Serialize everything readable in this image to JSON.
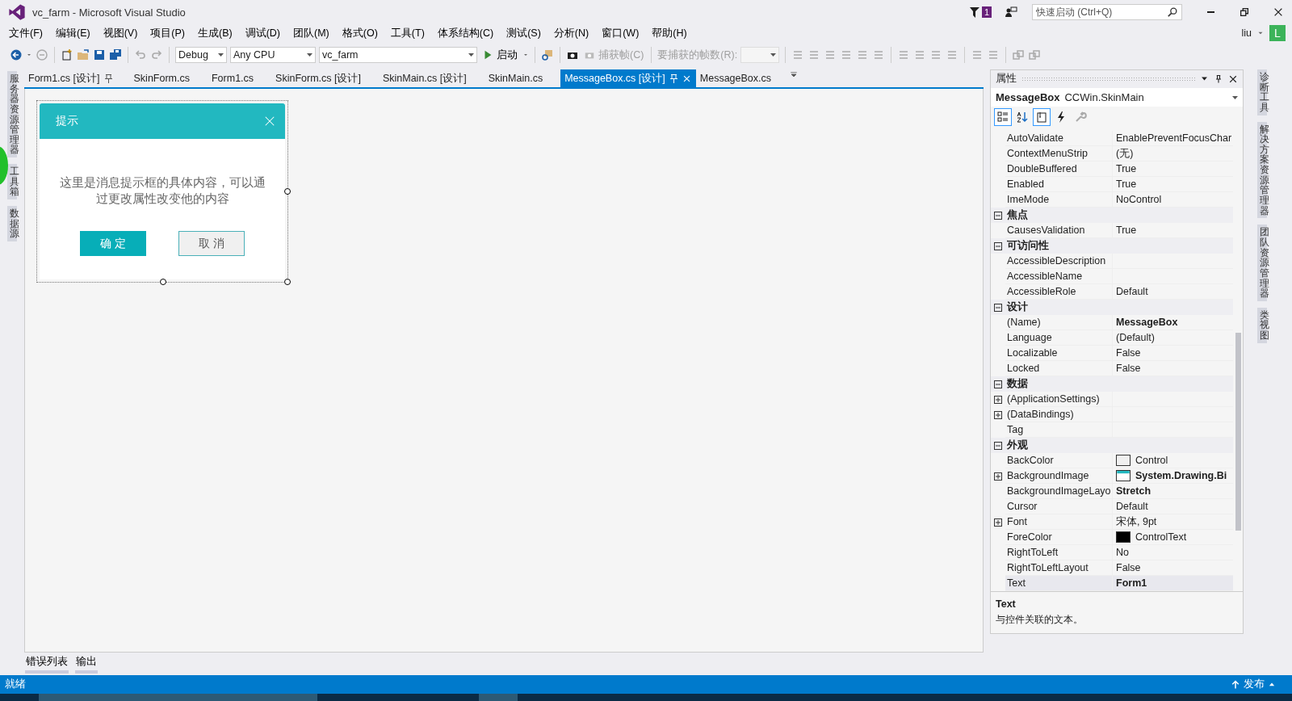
{
  "window": {
    "title": "vc_farm - Microsoft Visual Studio",
    "notification_count": "1",
    "quick_launch": {
      "placeholder": "快速启动 (Ctrl+Q)"
    }
  },
  "menu": [
    "文件(F)",
    "编辑(E)",
    "视图(V)",
    "项目(P)",
    "生成(B)",
    "调试(D)",
    "团队(M)",
    "格式(O)",
    "工具(T)",
    "体系结构(C)",
    "测试(S)",
    "分析(N)",
    "窗口(W)",
    "帮助(H)"
  ],
  "account": {
    "user": "liu",
    "initial": "L"
  },
  "toolbar": {
    "configuration": "Debug",
    "platform": "Any CPU",
    "project": "vc_farm",
    "start": "启动",
    "capture": {
      "label": "捕获帧(C)",
      "disabled": true
    },
    "frames_label": "要捕获的帧数(R):"
  },
  "left_strip": [
    "服务器资源管理器",
    "工具箱",
    "数据源"
  ],
  "right_strip": [
    "诊断工具",
    "解决方案资源管理器",
    "团队资源管理器",
    "类视图"
  ],
  "tabs": [
    {
      "label": "Form1.cs [设计]",
      "selected": false,
      "pinned": true
    },
    {
      "label": "SkinForm.cs",
      "selected": false,
      "pinned": false
    },
    {
      "label": "Form1.cs",
      "selected": false,
      "pinned": false
    },
    {
      "label": "SkinForm.cs [设计]",
      "selected": false,
      "pinned": false
    },
    {
      "label": "SkinMain.cs [设计]",
      "selected": false,
      "pinned": false
    },
    {
      "label": "SkinMain.cs",
      "selected": false,
      "pinned": false
    },
    {
      "label": "MessageBox.cs [设计]",
      "selected": true,
      "pinned": true
    },
    {
      "label": "MessageBox.cs",
      "selected": false,
      "pinned": false
    }
  ],
  "designer": {
    "dialog": {
      "title": "提示",
      "message": "这里是消息提示框的具体内容，可以通过更改属性改变他的内容",
      "buttons": [
        {
          "label": "确 定",
          "kind": "primary"
        },
        {
          "label": "取 消",
          "kind": "secondary"
        }
      ]
    }
  },
  "properties": {
    "title": "属性",
    "object_name": "MessageBox",
    "object_type": "CCWin.SkinMain",
    "tools": [
      {
        "kind": "categorized",
        "selected": true
      },
      {
        "kind": "alphabetical",
        "selected": false
      },
      {
        "kind": "properties",
        "selected": true
      },
      {
        "kind": "events",
        "selected": false
      },
      {
        "kind": "pages",
        "selected": false
      }
    ],
    "rows": [
      {
        "kind": "property",
        "name": "AutoValidate",
        "value": "EnablePreventFocusChar",
        "selected": false
      },
      {
        "kind": "property",
        "name": "ContextMenuStrip",
        "value": "(无)",
        "selected": false
      },
      {
        "kind": "property",
        "name": "DoubleBuffered",
        "value": "True",
        "selected": false
      },
      {
        "kind": "property",
        "name": "Enabled",
        "value": "True",
        "selected": false
      },
      {
        "kind": "property",
        "name": "ImeMode",
        "value": "NoControl",
        "selected": false
      },
      {
        "kind": "category",
        "name": "焦点",
        "expanded": true
      },
      {
        "kind": "property",
        "name": "CausesValidation",
        "value": "True",
        "selected": false
      },
      {
        "kind": "category",
        "name": "可访问性",
        "expanded": true
      },
      {
        "kind": "property",
        "name": "AccessibleDescription",
        "selected": false
      },
      {
        "kind": "property",
        "name": "AccessibleName",
        "selected": false
      },
      {
        "kind": "property",
        "name": "AccessibleRole",
        "value": "Default",
        "selected": false
      },
      {
        "kind": "category",
        "name": "设计",
        "expanded": true
      },
      {
        "kind": "property",
        "name": "(Name)",
        "value": "MessageBox",
        "bold": true,
        "selected": false
      },
      {
        "kind": "property",
        "name": "Language",
        "value": "(Default)",
        "selected": false
      },
      {
        "kind": "property",
        "name": "Localizable",
        "value": "False",
        "selected": false
      },
      {
        "kind": "property",
        "name": "Locked",
        "value": "False",
        "selected": false
      },
      {
        "kind": "category",
        "name": "数据",
        "expanded": true
      },
      {
        "kind": "property",
        "name": "(ApplicationSettings)",
        "expandable": true,
        "selected": false
      },
      {
        "kind": "property",
        "name": "(DataBindings)",
        "expandable": true,
        "selected": false
      },
      {
        "kind": "property",
        "name": "Tag",
        "selected": false
      },
      {
        "kind": "category",
        "name": "外观",
        "expanded": true
      },
      {
        "kind": "property",
        "name": "BackColor",
        "value": "Control",
        "color": "#f0f0f0",
        "selected": false
      },
      {
        "kind": "property",
        "name": "BackgroundImage",
        "value": "System.Drawing.Bi",
        "bold": true,
        "expandable": true,
        "image": true,
        "selected": false
      },
      {
        "kind": "property",
        "name": "BackgroundImageLayo",
        "value": "Stretch",
        "bold": true,
        "selected": false
      },
      {
        "kind": "property",
        "name": "Cursor",
        "value": "Default",
        "selected": false
      },
      {
        "kind": "property",
        "name": "Font",
        "value": "宋体, 9pt",
        "expandable": true,
        "selected": false
      },
      {
        "kind": "property",
        "name": "ForeColor",
        "value": "ControlText",
        "color": "#000000",
        "selected": false
      },
      {
        "kind": "property",
        "name": "RightToLeft",
        "value": "No",
        "selected": false
      },
      {
        "kind": "property",
        "name": "RightToLeftLayout",
        "value": "False",
        "selected": false
      },
      {
        "kind": "property",
        "name": "Text",
        "value": "Form1",
        "bold": true,
        "selected": true
      }
    ],
    "description": {
      "name": "Text",
      "text": "与控件关联的文本。"
    }
  },
  "bottom_tabs": [
    "错误列表",
    "输出"
  ],
  "status_bar": {
    "text": "就绪",
    "publish": "发布"
  }
}
